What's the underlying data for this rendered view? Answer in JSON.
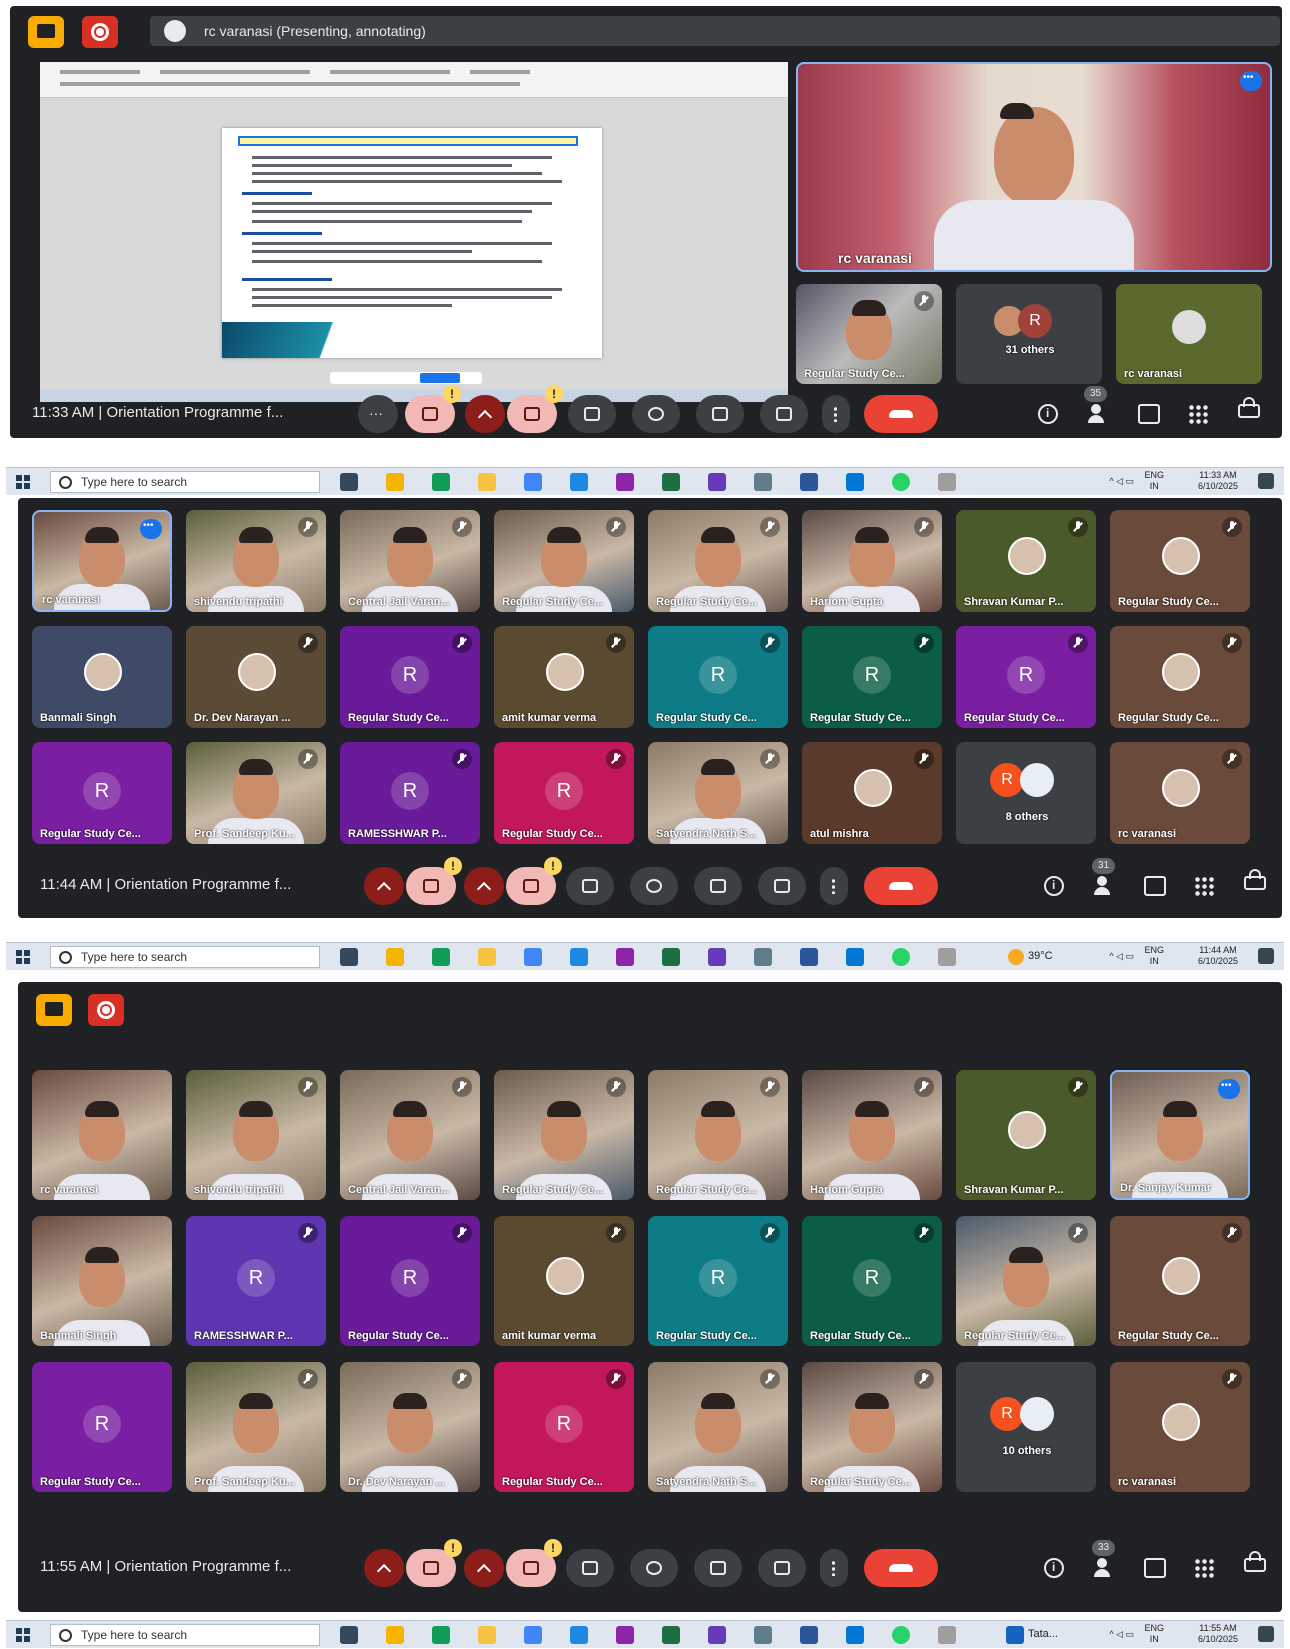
{
  "screens": [
    {
      "presenter_bar": "rc varanasi (Presenting, annotating)",
      "time": "11:33 AM",
      "meeting_title": "Orientation Programme f...",
      "participants_count": "35",
      "side_tiles": [
        {
          "name": "rc varanasi"
        },
        {
          "name": "Regular Study Ce..."
        },
        {
          "name": "31 others",
          "initial": "R"
        },
        {
          "name": "rc varanasi"
        }
      ]
    },
    {
      "time": "11:44 AM",
      "meeting_title": "Orientation Programme f...",
      "participants_count": "31",
      "tiles": [
        {
          "name": "rc varanasi",
          "kind": "video"
        },
        {
          "name": "shivendu tripathi",
          "kind": "video"
        },
        {
          "name": "Central Jail Varan...",
          "kind": "video"
        },
        {
          "name": "Regular Study Ce...",
          "kind": "video"
        },
        {
          "name": "Regular Study Ce...",
          "kind": "video"
        },
        {
          "name": "Hariom Gupta",
          "kind": "video"
        },
        {
          "name": "Shravan Kumar P...",
          "kind": "photo"
        },
        {
          "name": "Regular Study Ce...",
          "kind": "photo"
        },
        {
          "name": "Banmali Singh",
          "kind": "photo"
        },
        {
          "name": "Dr. Dev Narayan ...",
          "kind": "photo"
        },
        {
          "name": "Regular Study Ce...",
          "kind": "avatar",
          "initial": "R"
        },
        {
          "name": "amit kumar verma",
          "kind": "photo"
        },
        {
          "name": "Regular Study Ce...",
          "kind": "avatar",
          "initial": "R"
        },
        {
          "name": "Regular Study Ce...",
          "kind": "avatar",
          "initial": "R"
        },
        {
          "name": "Regular Study Ce...",
          "kind": "avatar",
          "initial": "R"
        },
        {
          "name": "Regular Study Ce...",
          "kind": "photo"
        },
        {
          "name": "Regular Study Ce...",
          "kind": "avatar",
          "initial": "R"
        },
        {
          "name": "Prof. Sandeep Ku...",
          "kind": "video"
        },
        {
          "name": "RAMESSHWAR P...",
          "kind": "avatar",
          "initial": "R"
        },
        {
          "name": "Regular Study Ce...",
          "kind": "avatar",
          "initial": "R"
        },
        {
          "name": "Satyendra Nath S...",
          "kind": "video"
        },
        {
          "name": "atul mishra",
          "kind": "photo"
        },
        {
          "name": "8 others",
          "kind": "others",
          "initial": "R"
        },
        {
          "name": "rc varanasi",
          "kind": "photo"
        }
      ]
    },
    {
      "time": "11:55 AM",
      "meeting_title": "Orientation Programme f...",
      "participants_count": "33",
      "tiles": [
        {
          "name": "rc varanasi",
          "kind": "video"
        },
        {
          "name": "shivendu tripathi",
          "kind": "video"
        },
        {
          "name": "Central Jail Varan...",
          "kind": "video"
        },
        {
          "name": "Regular Study Ce...",
          "kind": "video"
        },
        {
          "name": "Regular Study Ce...",
          "kind": "video"
        },
        {
          "name": "Hariom Gupta",
          "kind": "video"
        },
        {
          "name": "Shravan Kumar P...",
          "kind": "photo"
        },
        {
          "name": "Dr. Sanjay Kumar",
          "kind": "video"
        },
        {
          "name": "Banmali Singh",
          "kind": "video"
        },
        {
          "name": "RAMESSHWAR P...",
          "kind": "avatar",
          "initial": "R"
        },
        {
          "name": "Regular Study Ce...",
          "kind": "avatar",
          "initial": "R"
        },
        {
          "name": "amit kumar verma",
          "kind": "photo"
        },
        {
          "name": "Regular Study Ce...",
          "kind": "avatar",
          "initial": "R"
        },
        {
          "name": "Regular Study Ce...",
          "kind": "avatar",
          "initial": "R"
        },
        {
          "name": "Regular Study Ce...",
          "kind": "video"
        },
        {
          "name": "Regular Study Ce...",
          "kind": "photo"
        },
        {
          "name": "Regular Study Ce...",
          "kind": "avatar",
          "initial": "R"
        },
        {
          "name": "Prof. Sandeep Ku...",
          "kind": "video"
        },
        {
          "name": "Dr. Dev Narayan ...",
          "kind": "video"
        },
        {
          "name": "Regular Study Ce...",
          "kind": "avatar",
          "initial": "R"
        },
        {
          "name": "Satyendra Nath S...",
          "kind": "video"
        },
        {
          "name": "Regular Study Ce...",
          "kind": "video"
        },
        {
          "name": "10 others",
          "kind": "others",
          "initial": "R"
        },
        {
          "name": "rc varanasi",
          "kind": "photo"
        }
      ]
    }
  ],
  "taskbars": [
    {
      "search_placeholder": "Type here to search",
      "lang": "ENG",
      "region": "IN",
      "clock": "11:33 AM",
      "date": "6/10/2025"
    },
    {
      "search_placeholder": "Type here to search",
      "weather": "39°C",
      "lang": "ENG",
      "region": "IN",
      "clock": "11:44 AM",
      "date": "6/10/2025"
    },
    {
      "search_placeholder": "Type here to search",
      "app_label": "Tata...",
      "lang": "ENG",
      "region": "IN",
      "clock": "11:55 AM",
      "date": "6/10/2025"
    }
  ],
  "colors": {
    "meet_bg": "#202124",
    "end_call": "#ea4335",
    "avatar_teal": "#0e7c86",
    "avatar_purple": "#7b1fa2",
    "avatar_violet": "#5e35b1",
    "avatar_pink": "#c2185b",
    "avatar_green": "#0b5e45"
  }
}
